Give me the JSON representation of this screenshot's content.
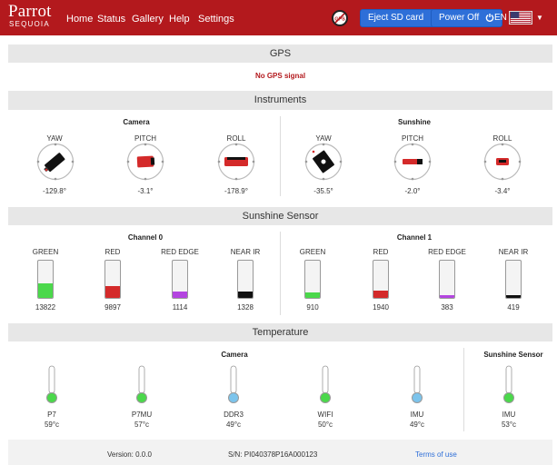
{
  "brand": {
    "name": "Parrot",
    "product": "SEQUOIA"
  },
  "nav": {
    "links": [
      "Home",
      "Status",
      "Gallery",
      "Help",
      "Settings"
    ],
    "gps_badge": "GPS",
    "eject_label": "Eject SD card",
    "power_label": "Power Off",
    "lang": "EN"
  },
  "gps": {
    "title": "GPS",
    "message": "No GPS signal"
  },
  "instruments": {
    "title": "Instruments",
    "camera": {
      "title": "Camera",
      "items": [
        {
          "label": "YAW",
          "value": "-129.8°"
        },
        {
          "label": "PITCH",
          "value": "-3.1°"
        },
        {
          "label": "ROLL",
          "value": "-178.9°"
        }
      ]
    },
    "sunshine": {
      "title": "Sunshine",
      "items": [
        {
          "label": "YAW",
          "value": "-35.5°"
        },
        {
          "label": "PITCH",
          "value": "-2.0°"
        },
        {
          "label": "ROLL",
          "value": "-3.4°"
        }
      ]
    }
  },
  "sensor": {
    "title": "Sunshine Sensor",
    "channel0": {
      "title": "Channel 0",
      "items": [
        {
          "label": "GREEN",
          "value": "13822",
          "level": 0.38,
          "color": "#4bd84b"
        },
        {
          "label": "RED",
          "value": "9897",
          "level": 0.32,
          "color": "#d42a2a"
        },
        {
          "label": "RED EDGE",
          "value": "1114",
          "level": 0.18,
          "color": "#b445e0"
        },
        {
          "label": "NEAR IR",
          "value": "1328",
          "level": 0.18,
          "color": "#111111"
        }
      ]
    },
    "channel1": {
      "title": "Channel 1",
      "items": [
        {
          "label": "GREEN",
          "value": "910",
          "level": 0.14,
          "color": "#4bd84b"
        },
        {
          "label": "RED",
          "value": "1940",
          "level": 0.2,
          "color": "#d42a2a"
        },
        {
          "label": "RED EDGE",
          "value": "383",
          "level": 0.07,
          "color": "#b445e0"
        },
        {
          "label": "NEAR IR",
          "value": "419",
          "level": 0.07,
          "color": "#111111"
        }
      ]
    }
  },
  "temperature": {
    "title": "Temperature",
    "camera_title": "Camera",
    "sunshine_title": "Sunshine Sensor",
    "items": [
      {
        "label": "P7",
        "value": "59°c",
        "color": "#4bd84b"
      },
      {
        "label": "P7MU",
        "value": "57°c",
        "color": "#4bd84b"
      },
      {
        "label": "DDR3",
        "value": "49°c",
        "color": "#7cc4ec"
      },
      {
        "label": "WIFI",
        "value": "50°c",
        "color": "#4bd84b"
      },
      {
        "label": "IMU",
        "value": "49°c",
        "color": "#7cc4ec"
      },
      {
        "label": "IMU",
        "value": "53°c",
        "color": "#4bd84b"
      }
    ]
  },
  "footer": {
    "version": "Version: 0.0.0",
    "serial": "S/N: PI040378P16A000123",
    "terms": "Terms of use"
  },
  "colors": {
    "brand_red": "#b3191d",
    "button_blue": "#2e6fd8",
    "section_gray": "#e7e7e7"
  }
}
